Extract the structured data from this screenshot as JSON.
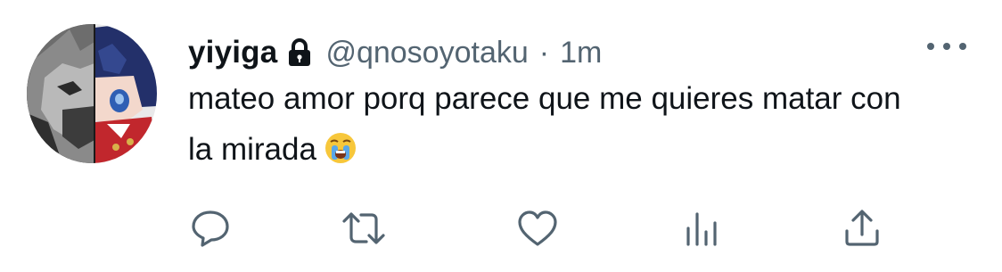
{
  "tweet": {
    "display_name": "yiyiga",
    "handle": "@qnosoyotaku",
    "separator": "·",
    "timestamp": "1m",
    "text": "mateo amor porq parece que me quieres matar con la mirada",
    "emoji": "loudly-crying-face",
    "protected": true
  },
  "icons": {
    "lock": "lock-icon",
    "more": "more-options-icon",
    "reply": "reply-icon",
    "retweet": "retweet-icon",
    "like": "like-icon",
    "analytics": "analytics-icon",
    "share": "share-icon"
  },
  "colors": {
    "text_primary": "#0f1419",
    "text_secondary": "#536471",
    "background": "#ffffff"
  }
}
